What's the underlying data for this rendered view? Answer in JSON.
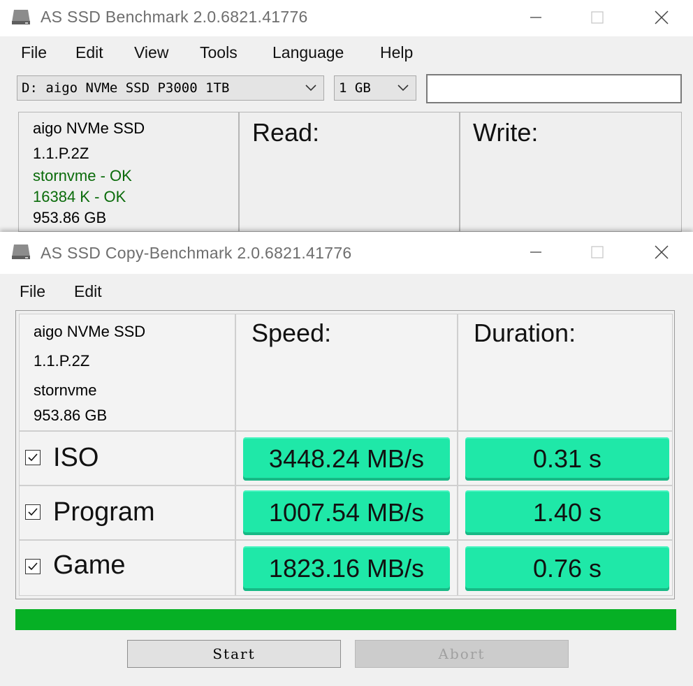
{
  "window1": {
    "title": "AS SSD Benchmark 2.0.6821.41776",
    "menu": [
      "File",
      "Edit",
      "View",
      "Tools",
      "Language",
      "Help"
    ],
    "drive_select": "D: aigo NVMe SSD P3000 1TB",
    "size_select": "1 GB",
    "info": {
      "model": "aigo NVMe SSD",
      "firmware": "1.1.P.2Z",
      "driver_status": "stornvme - OK",
      "alignment_status": "16384 K - OK",
      "capacity": "953.86 GB"
    },
    "columns": {
      "read": "Read:",
      "write": "Write:"
    }
  },
  "window2": {
    "title": "AS SSD Copy-Benchmark 2.0.6821.41776",
    "menu": [
      "File",
      "Edit"
    ],
    "info": {
      "model": "aigo NVMe SSD",
      "firmware": "1.1.P.2Z",
      "driver": "stornvme",
      "capacity": "953.86 GB"
    },
    "columns": {
      "speed": "Speed:",
      "duration": "Duration:"
    },
    "rows": [
      {
        "label": "ISO",
        "checked": true,
        "speed": "3448.24 MB/s",
        "duration": "0.31 s"
      },
      {
        "label": "Program",
        "checked": true,
        "speed": "1007.54 MB/s",
        "duration": "1.40 s"
      },
      {
        "label": "Game",
        "checked": true,
        "speed": "1823.16 MB/s",
        "duration": "0.76 s"
      }
    ],
    "progress_fraction": 1.0,
    "buttons": {
      "start": "Start",
      "abort": "Abort"
    }
  },
  "colors": {
    "result_fill": "#1fe8a8",
    "progress": "#06b025",
    "ok_text": "#0a6b0a"
  },
  "icons": [
    "drive-icon",
    "minimize-icon",
    "maximize-icon",
    "close-icon",
    "chevron-down-icon",
    "checkbox-checked-icon"
  ]
}
